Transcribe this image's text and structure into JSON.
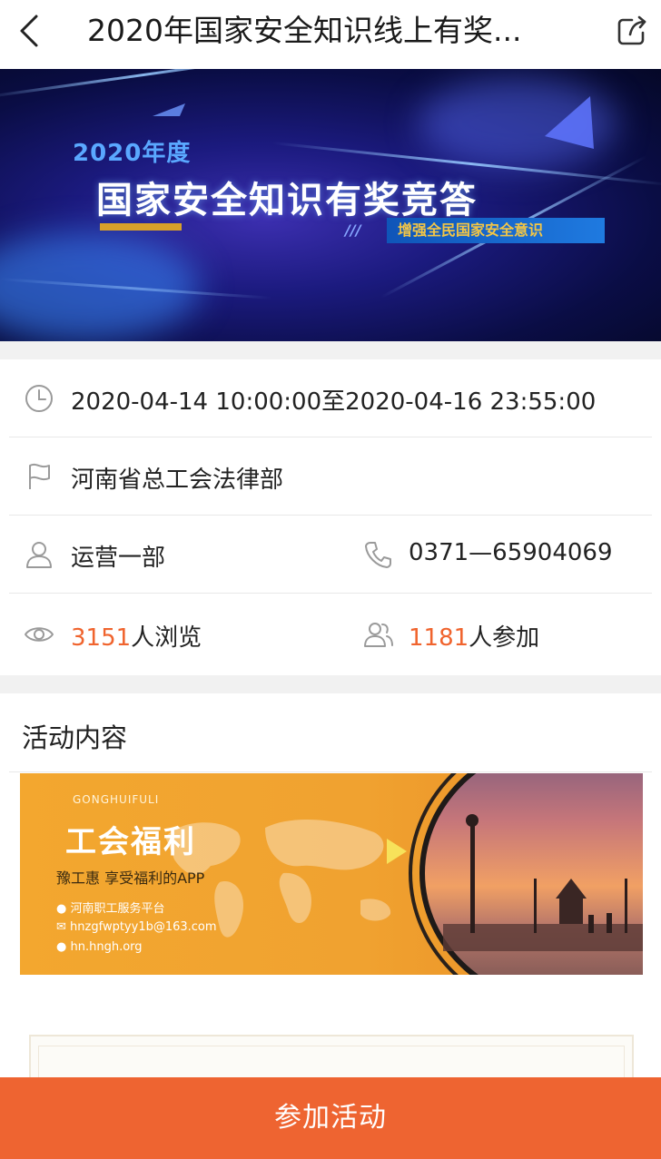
{
  "header": {
    "title": "2020年国家安全知识线上有奖..."
  },
  "banner": {
    "year": "2020年度",
    "main": "国家安全知识有奖竞答",
    "slashes": "///",
    "tag": "增强全民国家安全意识"
  },
  "info": {
    "time": "2020-04-14 10:00:00至2020-04-16 23:55:00",
    "organizer": "河南省总工会法律部",
    "contact": "运营一部",
    "phone": "0371—65904069",
    "views_count": "3151",
    "views_suffix": "人浏览",
    "join_count": "1181",
    "join_suffix": "人参加"
  },
  "section": {
    "title": "活动内容"
  },
  "ad": {
    "sub": "GONGHUIFULI",
    "title": "工会福利",
    "slogan": "豫工惠  享受福利的APP",
    "platform": "河南职工服务平台",
    "email": "hnzgfwptyy1b@163.com",
    "site": "hn.hngh.org"
  },
  "footer": {
    "join_label": "参加活动"
  },
  "colors": {
    "accent": "#ee6431",
    "highlight": "#f0642e"
  }
}
